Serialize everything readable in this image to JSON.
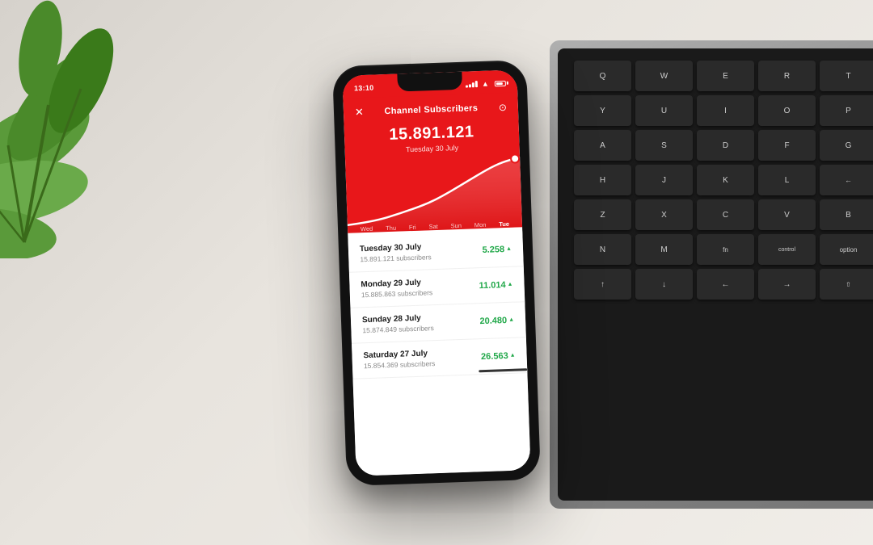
{
  "scene": {
    "background": "#e8e4de"
  },
  "phone": {
    "status_bar": {
      "time": "13:10",
      "signal": true,
      "wifi": true,
      "battery": true
    },
    "nav": {
      "close_label": "✕",
      "title": "Channel Subscribers",
      "camera_label": "⊙"
    },
    "stats": {
      "main_number": "15.891.121",
      "date": "Tuesday 30 July"
    },
    "chart": {
      "day_labels": [
        "Wed",
        "Thu",
        "Fri",
        "Sat",
        "Sun",
        "Mon",
        "Tue"
      ],
      "active_label": "Tue"
    },
    "list": [
      {
        "day": "Tuesday 30 July",
        "subscribers": "15.891.121 subscribers",
        "gain": "5.258",
        "up": true
      },
      {
        "day": "Monday 29 July",
        "subscribers": "15.885.863 subscribers",
        "gain": "11.014",
        "up": true
      },
      {
        "day": "Sunday 28 July",
        "subscribers": "15.874.849 subscribers",
        "gain": "20.480",
        "up": true
      },
      {
        "day": "Saturday 27 July",
        "subscribers": "15.854.369 subscribers",
        "gain": "26.563",
        "up": true
      }
    ]
  },
  "keyboard": {
    "keys": [
      "Q",
      "W",
      "E",
      "R",
      "T",
      "Y",
      "U",
      "I",
      "O",
      "P",
      "A",
      "S",
      "D",
      "F",
      "G",
      "H",
      "J",
      "K",
      "L",
      "←",
      "Z",
      "X",
      "C",
      "V",
      "B",
      "N",
      "M",
      "fn",
      "control",
      "option"
    ]
  },
  "detected_text": {
    "option_label": "option"
  }
}
